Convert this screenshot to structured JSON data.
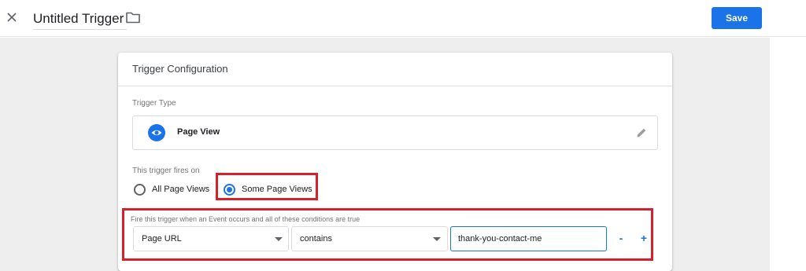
{
  "header": {
    "title": "Untitled Trigger",
    "save_label": "Save",
    "close_icon": "close-icon",
    "folder_icon": "folder-icon"
  },
  "card": {
    "title": "Trigger Configuration",
    "trigger_type_label": "Trigger Type",
    "trigger_type": {
      "name": "Page View",
      "icon": "eye-icon",
      "edit_icon": "pencil-icon"
    },
    "fires_on_label": "This trigger fires on",
    "fires_on_options": [
      {
        "label": "All Page Views",
        "selected": false
      },
      {
        "label": "Some Page Views",
        "selected": true
      }
    ],
    "conditions_label": "Fire this trigger when an Event occurs and all of these conditions are true",
    "condition": {
      "variable": "Page URL",
      "operator": "contains",
      "value": "thank-you-contact-me"
    },
    "remove_label": "-",
    "add_label": "+"
  },
  "colors": {
    "accent": "#1a73e8",
    "highlight": "#d6202b",
    "canvas": "#eeeeee"
  }
}
